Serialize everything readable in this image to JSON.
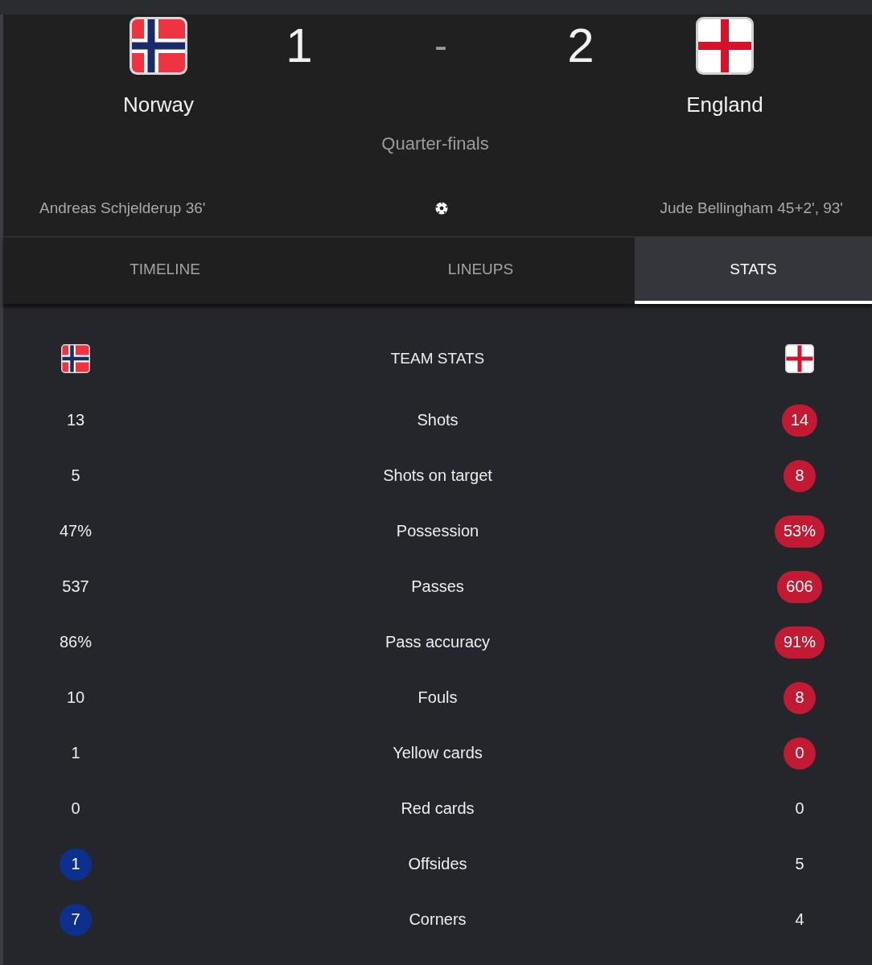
{
  "match": {
    "teams": [
      {
        "name": "Norway",
        "kind": "nordic",
        "color": "#0d2f8e",
        "score": "1"
      },
      {
        "name": "England",
        "kind": "george",
        "color": "#c21a32",
        "score": "2"
      }
    ],
    "separator": "-",
    "round": "Quarter-finals",
    "scorers": [
      "Andreas Schjelderup 36'",
      "Jude Bellingham 45+2', 93'"
    ]
  },
  "tabs": [
    {
      "label": "TIMELINE",
      "selected": false
    },
    {
      "label": "LINEUPS",
      "selected": false
    },
    {
      "label": "STATS",
      "selected": true
    }
  ],
  "team_stats": {
    "title": "TEAM STATS",
    "rows": [
      {
        "label": "Shots",
        "home": {
          "value": "13",
          "highlighted": false
        },
        "away": {
          "value": "14",
          "highlighted": true
        }
      },
      {
        "label": "Shots on target",
        "home": {
          "value": "5",
          "highlighted": false
        },
        "away": {
          "value": "8",
          "highlighted": true
        }
      },
      {
        "label": "Possession",
        "home": {
          "value": "47%",
          "highlighted": false
        },
        "away": {
          "value": "53%",
          "highlighted": true
        }
      },
      {
        "label": "Passes",
        "home": {
          "value": "537",
          "highlighted": false
        },
        "away": {
          "value": "606",
          "highlighted": true
        }
      },
      {
        "label": "Pass accuracy",
        "home": {
          "value": "86%",
          "highlighted": false
        },
        "away": {
          "value": "91%",
          "highlighted": true
        }
      },
      {
        "label": "Fouls",
        "home": {
          "value": "10",
          "highlighted": false
        },
        "away": {
          "value": "8",
          "highlighted": true
        }
      },
      {
        "label": "Yellow cards",
        "home": {
          "value": "1",
          "highlighted": false
        },
        "away": {
          "value": "0",
          "highlighted": true
        }
      },
      {
        "label": "Red cards",
        "home": {
          "value": "0",
          "highlighted": false
        },
        "away": {
          "value": "0",
          "highlighted": false
        }
      },
      {
        "label": "Offsides",
        "home": {
          "value": "1",
          "highlighted": true
        },
        "away": {
          "value": "5",
          "highlighted": false
        }
      },
      {
        "label": "Corners",
        "home": {
          "value": "7",
          "highlighted": true
        },
        "away": {
          "value": "4",
          "highlighted": false
        }
      }
    ]
  }
}
